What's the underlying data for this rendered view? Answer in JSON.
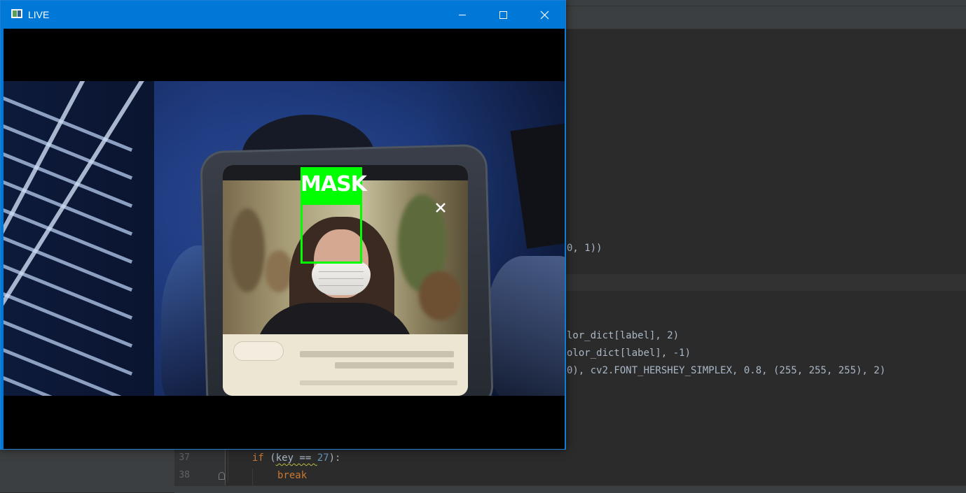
{
  "window": {
    "title": "LIVE",
    "controls": {
      "minimize": "minimize",
      "maximize": "maximize",
      "close": "close"
    },
    "accent_color": "#0078d7"
  },
  "detection": {
    "label": "MASK",
    "color": "#00ff00"
  },
  "editor": {
    "partial_lines": [
      "0, 1))",
      "lor_dict[label], 2)",
      "olor_dict[label], -1)",
      "0), cv2.FONT_HERSHEY_SIMPLEX, 0.8, (255, 255, 255), 2)"
    ],
    "lines": [
      {
        "number": "37",
        "keyword": "if",
        "rest_before": " (",
        "squiggled": "key == ",
        "num": "27",
        "rest_after": "):"
      },
      {
        "number": "38",
        "keyword": "break"
      }
    ]
  }
}
